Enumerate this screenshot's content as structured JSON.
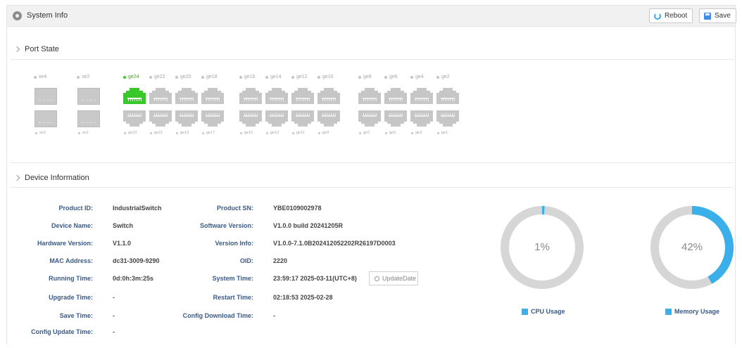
{
  "header": {
    "title": "System Info",
    "reboot_label": "Reboot",
    "save_label": "Save"
  },
  "port_state": {
    "title": "Port State",
    "sfp_top": [
      "xe4",
      "xe2"
    ],
    "sfp_bottom": [
      "xe3",
      "xe1"
    ],
    "ge_top": [
      "ge24",
      "ge22",
      "ge20",
      "ge18",
      "ge16",
      "ge14",
      "ge12",
      "ge10",
      "ge8",
      "ge6",
      "ge4",
      "ge2"
    ],
    "ge_bottom": [
      "ge23",
      "ge21",
      "ge19",
      "ge17",
      "ge15",
      "ge13",
      "ge11",
      "ge9",
      "ge7",
      "ge5",
      "ge3",
      "ge1"
    ],
    "active_ports": [
      "ge24"
    ],
    "colors": {
      "active": "#39c82a",
      "inactive": "#c4c4c4"
    }
  },
  "device": {
    "title": "Device Information",
    "left": [
      {
        "label": "Product ID:",
        "value": "IndustrialSwitch"
      },
      {
        "label": "Device Name:",
        "value": "Switch"
      },
      {
        "label": "Hardware Version:",
        "value": "V1.1.0"
      },
      {
        "label": "MAC Address:",
        "value": "dc31-3009-9290"
      },
      {
        "label": "Running Time:",
        "value": "0d:0h:3m:25s"
      },
      {
        "label": "Upgrade Time:",
        "value": "-"
      },
      {
        "label": "Save Time:",
        "value": "-"
      },
      {
        "label": "Config Update Time:",
        "value": "-"
      }
    ],
    "right": [
      {
        "label": "Product SN:",
        "value": "YBE0109002978"
      },
      {
        "label": "Software Version:",
        "value": "V1.0.0 build 20241205R"
      },
      {
        "label": "Version Info:",
        "value": "V1.0.0-7.1.0B202412052202R26197D0003"
      },
      {
        "label": "OID:",
        "value": "2220"
      },
      {
        "label": "System Time:",
        "value": "23:59:17 2025-03-11(UTC+8)"
      },
      {
        "label": "Restart Time:",
        "value": "02:18:53 2025-02-28"
      },
      {
        "label": "Config Download Time:",
        "value": "-"
      }
    ],
    "update_date_label": "UpdateDate"
  },
  "usage": {
    "cpu": {
      "percent": 1,
      "text": "1%",
      "legend": "CPU Usage"
    },
    "memory": {
      "percent": 42,
      "text": "42%",
      "legend": "Memory Usage"
    },
    "colors": {
      "fill": "#3aafe9",
      "track": "#d6d6d6"
    }
  }
}
